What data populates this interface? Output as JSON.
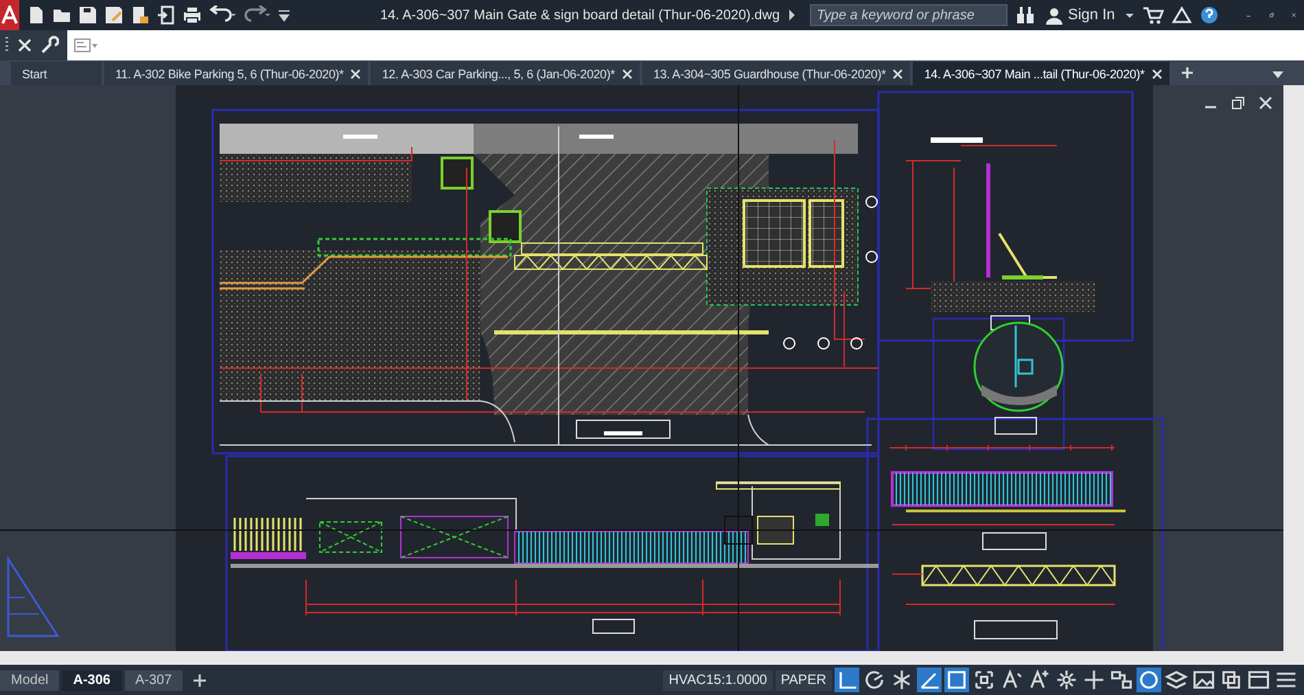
{
  "window": {
    "title": "14. A-306~307 Main Gate & sign board detail (Thur-06-2020).dwg"
  },
  "search": {
    "placeholder": "Type a keyword or phrase"
  },
  "account": {
    "label": "Sign In"
  },
  "file_tabs": [
    {
      "label": "Start",
      "selected": false,
      "closable": false
    },
    {
      "label": "11. A-302 Bike Parking 5, 6 (Thur-06-2020)*",
      "selected": false,
      "closable": true
    },
    {
      "label": "12. A-303 Car Parking..., 5, 6 (Jan-06-2020)*",
      "selected": false,
      "closable": true
    },
    {
      "label": "13. A-304~305 Guardhouse (Thur-06-2020)*",
      "selected": false,
      "closable": true
    },
    {
      "label": "14. A-306~307 Main ...tail (Thur-06-2020)*",
      "selected": true,
      "closable": true
    }
  ],
  "layout_tabs": [
    {
      "label": "Model",
      "selected": false
    },
    {
      "label": "A-306",
      "selected": true
    },
    {
      "label": "A-307",
      "selected": false
    }
  ],
  "status_bar": {
    "scale": "HVAC15:1.0000",
    "space": "PAPER",
    "toggles": [
      {
        "kind": "ortho",
        "on": true
      },
      {
        "kind": "polar",
        "on": false
      },
      {
        "kind": "isodraft",
        "on": false
      },
      {
        "kind": "angle",
        "on": true
      },
      {
        "kind": "frame",
        "on": true
      },
      {
        "kind": "scale",
        "on": false
      },
      {
        "kind": "annotate",
        "on": false
      },
      {
        "kind": "annoauto",
        "on": false
      },
      {
        "kind": "gear",
        "on": false
      },
      {
        "kind": "plus",
        "on": false
      },
      {
        "kind": "units",
        "on": false
      },
      {
        "kind": "isolate",
        "on": true
      },
      {
        "kind": "hardware",
        "on": false
      },
      {
        "kind": "clean",
        "on": false
      },
      {
        "kind": "layers",
        "on": false
      },
      {
        "kind": "fullscreen",
        "on": false
      },
      {
        "kind": "menu",
        "on": false
      }
    ]
  }
}
